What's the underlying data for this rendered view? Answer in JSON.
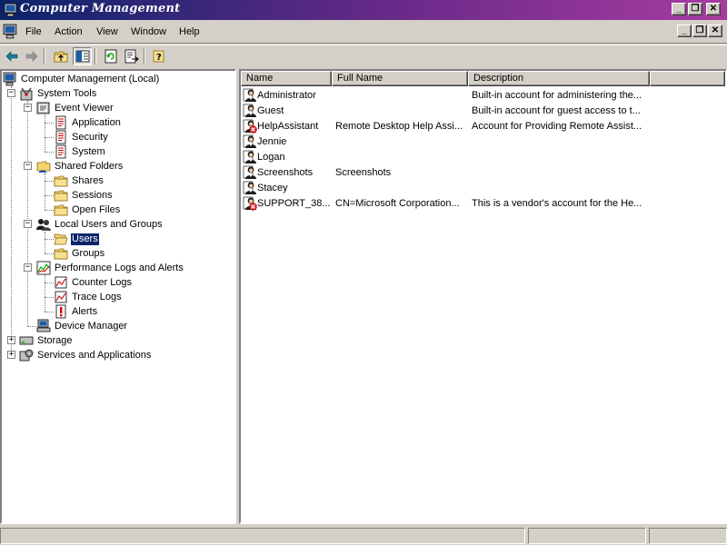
{
  "window": {
    "title": "Computer Management"
  },
  "menu": [
    "File",
    "Action",
    "View",
    "Window",
    "Help"
  ],
  "tree": [
    {
      "label": "Computer Management (Local)",
      "icon": "computer-management-icon"
    },
    {
      "label": "System Tools",
      "icon": "system-tools-icon"
    },
    {
      "label": "Event Viewer",
      "icon": "event-viewer-icon"
    },
    {
      "label": "Application",
      "icon": "log-icon"
    },
    {
      "label": "Security",
      "icon": "log-icon"
    },
    {
      "label": "System",
      "icon": "log-icon"
    },
    {
      "label": "Shared Folders",
      "icon": "shared-folders-icon"
    },
    {
      "label": "Shares",
      "icon": "folder-icon"
    },
    {
      "label": "Sessions",
      "icon": "folder-icon"
    },
    {
      "label": "Open Files",
      "icon": "folder-icon"
    },
    {
      "label": "Local Users and Groups",
      "icon": "users-groups-icon"
    },
    {
      "label": "Users",
      "icon": "folder-open-icon"
    },
    {
      "label": "Groups",
      "icon": "folder-icon"
    },
    {
      "label": "Performance Logs and Alerts",
      "icon": "performance-icon"
    },
    {
      "label": "Counter Logs",
      "icon": "chart-log-icon"
    },
    {
      "label": "Trace Logs",
      "icon": "chart-log-icon"
    },
    {
      "label": "Alerts",
      "icon": "alert-icon"
    },
    {
      "label": "Device Manager",
      "icon": "device-manager-icon"
    },
    {
      "label": "Storage",
      "icon": "storage-icon"
    },
    {
      "label": "Services and Applications",
      "icon": "services-icon"
    }
  ],
  "list": {
    "columns": [
      "Name",
      "Full Name",
      "Description"
    ],
    "rows": [
      {
        "name": "Administrator",
        "full_name": "",
        "description": "Built-in account for administering the...",
        "disabled": false
      },
      {
        "name": "Guest",
        "full_name": "",
        "description": "Built-in account for guest access to t...",
        "disabled": false
      },
      {
        "name": "HelpAssistant",
        "full_name": "Remote Desktop Help Assi...",
        "description": "Account for Providing Remote Assist...",
        "disabled": true
      },
      {
        "name": "Jennie",
        "full_name": "",
        "description": "",
        "disabled": false
      },
      {
        "name": "Logan",
        "full_name": "",
        "description": "",
        "disabled": false
      },
      {
        "name": "Screenshots",
        "full_name": "Screenshots",
        "description": "",
        "disabled": false
      },
      {
        "name": "Stacey",
        "full_name": "",
        "description": "",
        "disabled": false
      },
      {
        "name": "SUPPORT_38...",
        "full_name": "CN=Microsoft Corporation...",
        "description": "This is a vendor's account for the He...",
        "disabled": true
      }
    ]
  },
  "colors": {
    "selection": "#0a246a",
    "face": "#d4d0c8",
    "title_start": "#0a246a",
    "title_end": "#a83ca0"
  }
}
